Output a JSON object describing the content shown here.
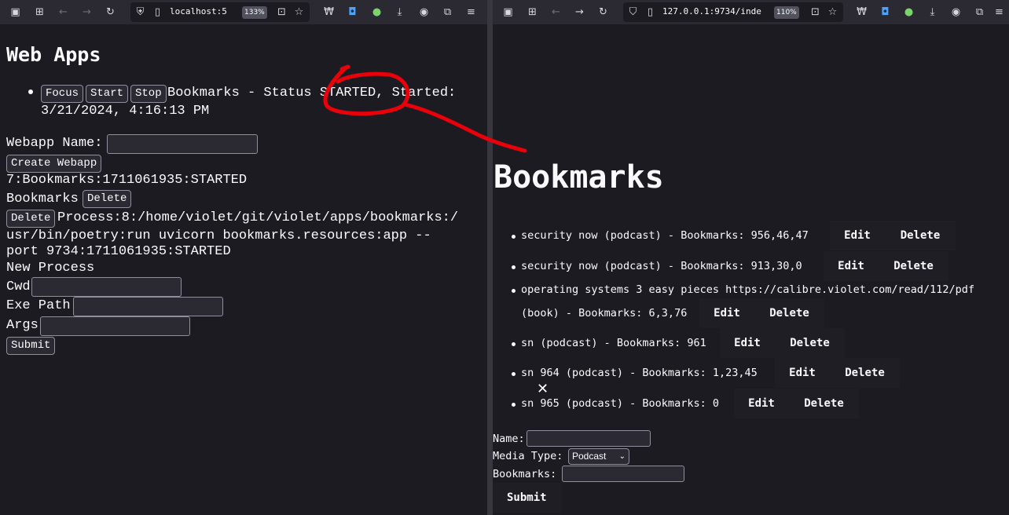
{
  "left": {
    "url": "localhost:5",
    "zoom": "133%",
    "title": "Web Apps",
    "buttons": {
      "focus": "Focus",
      "start": "Start",
      "stop": "Stop"
    },
    "app_status_line1": "Bookmarks - Status  STARTED, Started:",
    "app_status_line2": "3/21/2024, 4:16:13 PM",
    "webapp_name_label": "Webapp Name:",
    "create_webapp": "Create Webapp",
    "webapp_record": "7:Bookmarks:1711061935:STARTED",
    "bookmarks_label": "Bookmarks",
    "delete_label": "Delete",
    "process_line1": "Process:8:/home/violet/git/violet/apps/bookmarks:/",
    "process_line2": "usr/bin/poetry:run uvicorn bookmarks.resources:app --",
    "process_line3": "port 9734:1711061935:STARTED",
    "new_process": "New Process",
    "cwd_label": "Cwd",
    "exe_path_label": "Exe Path",
    "args_label": "Args",
    "submit": "Submit"
  },
  "right": {
    "url": "127.0.0.1:9734/inde",
    "zoom": "110%",
    "title": "Bookmarks",
    "items": [
      {
        "text": "security now (podcast) - Bookmarks: 956,46,47",
        "edit": "Edit",
        "delete": "Delete"
      },
      {
        "text": "security now (podcast) - Bookmarks: 913,30,0",
        "edit": "Edit",
        "delete": "Delete"
      },
      {
        "text": "operating systems 3 easy pieces https://calibre.violet.com/read/112/pdf",
        "text2": "(book) - Bookmarks: 6,3,76",
        "edit": "Edit",
        "delete": "Delete"
      },
      {
        "text": "sn (podcast) - Bookmarks: 961",
        "edit": "Edit",
        "delete": "Delete"
      },
      {
        "text": "sn 964 (podcast) - Bookmarks: 1,23,45",
        "edit": "Edit",
        "delete": "Delete"
      },
      {
        "text": "sn 965 (podcast) - Bookmarks: 0",
        "edit": "Edit",
        "delete": "Delete"
      }
    ],
    "name_label": "Name:",
    "media_type_label": "Media Type:",
    "media_type_value": "Podcast",
    "bookmarks_label": "Bookmarks:",
    "submit": "Submit"
  },
  "colors": {
    "background": "#1c1b22",
    "toolbar": "#2b2a33",
    "annotation": "#e8000a"
  }
}
